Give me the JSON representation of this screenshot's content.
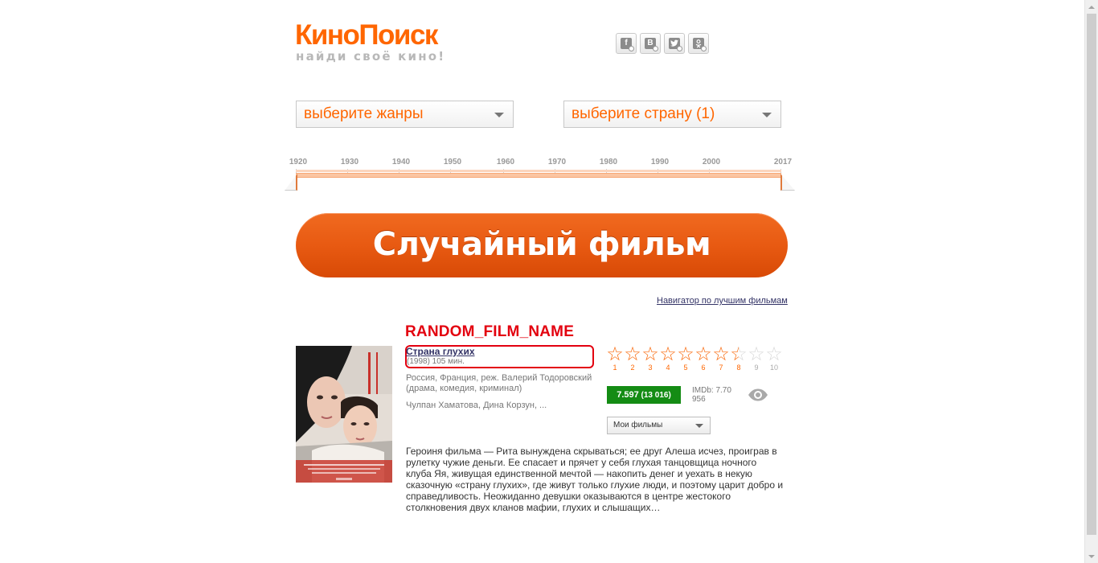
{
  "logo": {
    "name": "КиноПоиск",
    "tagline": "найди своё кино!"
  },
  "social": [
    {
      "icon": "facebook-icon",
      "glyph": "f"
    },
    {
      "icon": "vkontakte-icon",
      "glyph": "B"
    },
    {
      "icon": "twitter-icon",
      "glyph": "t"
    },
    {
      "icon": "odnoklassniki-icon",
      "glyph": "ok"
    }
  ],
  "filters": {
    "genre_placeholder": "выберите жанры",
    "country_value": "выберите страну (1)"
  },
  "years": {
    "labels": [
      "1920",
      "1930",
      "1940",
      "1950",
      "1960",
      "1970",
      "1980",
      "1990",
      "2000",
      "2017"
    ],
    "range_from": 1920,
    "range_to": 2017
  },
  "random_button": "Случайный фильм",
  "navigator_link": "Навигатор по лучшим фильмам",
  "film": {
    "marker": "RANDOM_FILM_NAME",
    "title": "Страна глухих",
    "meta": "(1998) 105 мин.",
    "info": "Россия, Франция, реж. Валерий Тодоровский (драма, комедия, криминал)",
    "cast": "Чулпан Хаматова, Дина Корзун, ...",
    "rating_labels": [
      "1",
      "2",
      "3",
      "4",
      "5",
      "6",
      "7",
      "8",
      "9",
      "10"
    ],
    "user_rating": 7.597,
    "kp_rating": "7.597",
    "kp_votes": "(13 016)",
    "imdb_line1": "IMDb: 7.70",
    "imdb_line2": "956",
    "my_films": "Мои фильмы",
    "description": "Героиня фильма — Рита вынуждена скрываться; ее друг Алеша исчез, проиграв в рулетку чужие деньги. Ее спасает и прячет у себя глухая танцовщица ночного клуба Яя, живущая единственной мечтой — накопить денег и уехать в некую сказочную «страну глухих», где живут только глухие люди, и поэтому царит добро и справедливость. Неожиданно девушки оказываются в центре жестокого столкновения двух кланов мафии, глухих и слышащих…"
  },
  "colors": {
    "brand": "#ff6600",
    "marker": "#e3000f",
    "rating_bg": "#148c14"
  }
}
